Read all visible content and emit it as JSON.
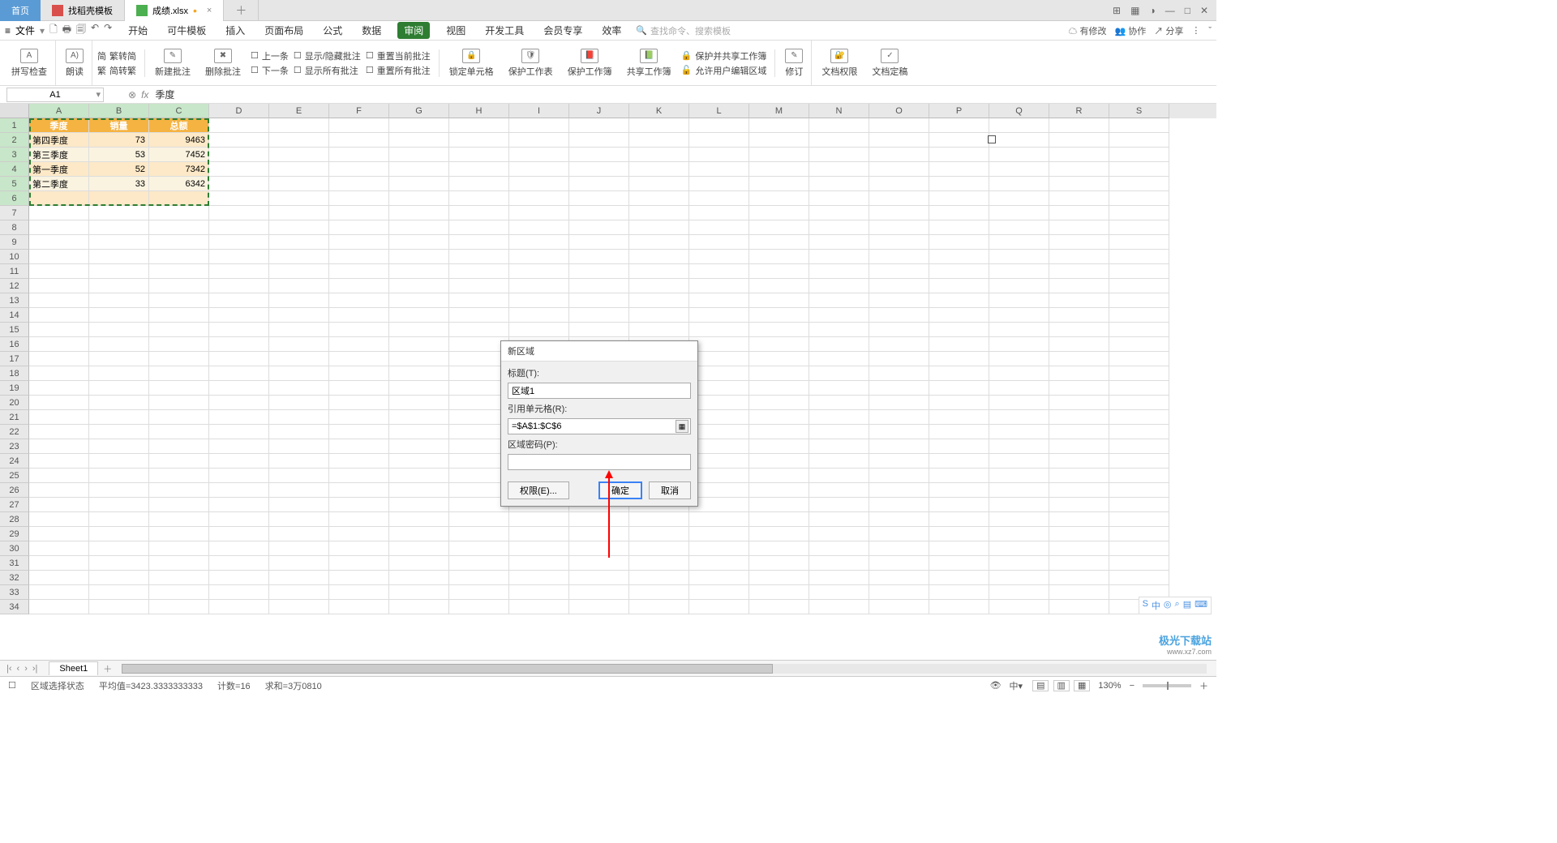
{
  "title_tabs": {
    "home": "首页",
    "t1": "找稻壳模板",
    "t2": "成绩.xlsx"
  },
  "win": {
    "layout": "⊞",
    "grid": "▦",
    "user": "◑",
    "min": "—",
    "max": "□",
    "close": "✕"
  },
  "menu": {
    "file": "文件",
    "items": [
      "开始",
      "可牛模板",
      "插入",
      "页面布局",
      "公式",
      "数据",
      "审阅",
      "视图",
      "开发工具",
      "会员专享",
      "效率"
    ],
    "active_index": 6,
    "search_placeholder": "查找命令、搜索模板",
    "has_changes": "有修改",
    "collab": "协作",
    "share": "分享"
  },
  "ribbon": {
    "spellcheck": "拼写检查",
    "read_aloud": "朗读",
    "g_convert": {
      "a": "繁转简",
      "b": "简转繁"
    },
    "new_comment": "新建批注",
    "del_comment": "删除批注",
    "prev": "上一条",
    "next": "下一条",
    "show_hide": "显示/隐藏批注",
    "show_all": "显示所有批注",
    "reset_cur": "重置当前批注",
    "reset_all": "重置所有批注",
    "lock_cell": "锁定单元格",
    "protect_sheet": "保护工作表",
    "protect_book": "保护工作簿",
    "share_book": "共享工作簿",
    "protect_share": "保护并共享工作簿",
    "allow_edit": "允许用户编辑区域",
    "revise": "修订",
    "doc_perm": "文档权限",
    "doc_encrypt": "文档定稿"
  },
  "formula": {
    "cell_ref": "A1",
    "value": "季度"
  },
  "columns": [
    "A",
    "B",
    "C",
    "D",
    "E",
    "F",
    "G",
    "H",
    "I",
    "J",
    "K",
    "L",
    "M",
    "N",
    "O",
    "P",
    "Q",
    "R",
    "S"
  ],
  "row_count": 34,
  "table": {
    "headers": [
      "季度",
      "销量",
      "总额"
    ],
    "rows": [
      [
        "第四季度",
        "73",
        "9463"
      ],
      [
        "第三季度",
        "53",
        "7452"
      ],
      [
        "第一季度",
        "52",
        "7342"
      ],
      [
        "第二季度",
        "33",
        "6342"
      ]
    ]
  },
  "dialog": {
    "title": "新区域",
    "label_title": "标题(T):",
    "val_title": "区域1",
    "label_ref": "引用单元格(R):",
    "val_ref": "=$A$1:$C$6",
    "label_pwd": "区域密码(P):",
    "val_pwd": "",
    "btn_perm": "权限(E)...",
    "btn_ok": "确定",
    "btn_cancel": "取消"
  },
  "sheet_tab": "Sheet1",
  "status": {
    "mode": "区域选择状态",
    "avg": "平均值=3423.3333333333",
    "count": "计数=16",
    "sum": "求和=3万0810",
    "zoom": "130%"
  },
  "ime": [
    "S",
    "中",
    "◎",
    "⌕",
    "▤",
    "⌨"
  ],
  "watermark": {
    "line1": "极光下载站",
    "line2": "www.xz7.com"
  }
}
